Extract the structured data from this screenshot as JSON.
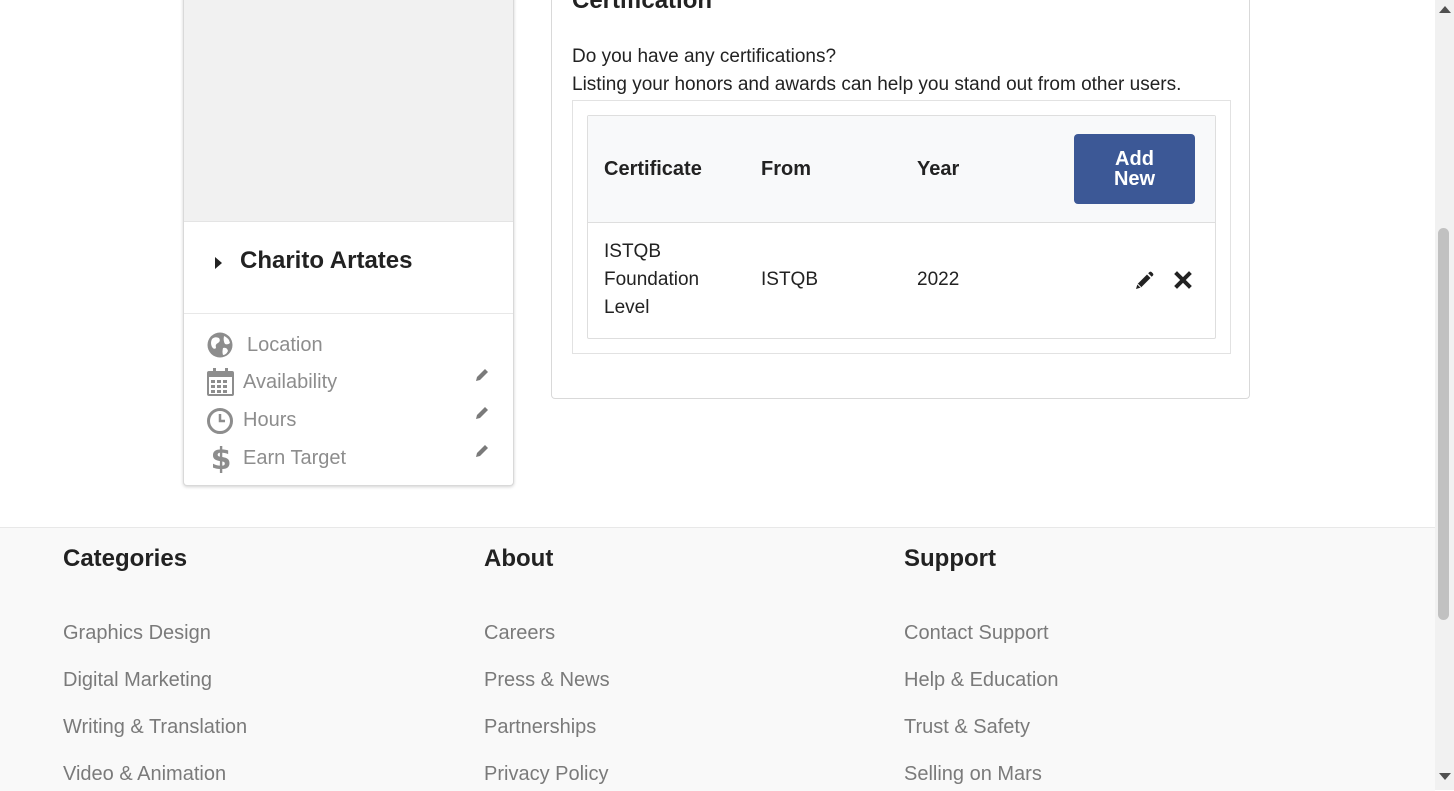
{
  "profile": {
    "name": "Charito Artates",
    "details": [
      {
        "label": "Location",
        "icon": "globe-icon",
        "editable": false
      },
      {
        "label": "Availability",
        "icon": "calendar-icon",
        "editable": true
      },
      {
        "label": "Hours",
        "icon": "clock-icon",
        "editable": true
      },
      {
        "label": "Earn Target",
        "icon": "dollar-icon",
        "editable": true
      }
    ]
  },
  "certification": {
    "title": "Certification",
    "question": "Do you have any certifications?",
    "description": "Listing your honors and awards can help you stand out from other users.",
    "columns": [
      "Certificate",
      "From",
      "Year"
    ],
    "add_button": "Add New",
    "rows": [
      {
        "certificate": "ISTQB Foundation Level",
        "from": "ISTQB",
        "year": "2022"
      }
    ]
  },
  "footer": {
    "columns": [
      {
        "heading": "Categories",
        "links": [
          "Graphics Design",
          "Digital Marketing",
          "Writing & Translation",
          "Video & Animation"
        ]
      },
      {
        "heading": "About",
        "links": [
          "Careers",
          "Press & News",
          "Partnerships",
          "Privacy Policy"
        ]
      },
      {
        "heading": "Support",
        "links": [
          "Contact Support",
          "Help & Education",
          "Trust & Safety",
          "Selling on Mars"
        ]
      }
    ]
  },
  "colors": {
    "primary_button": "#3c5896",
    "muted_text": "#8d8d8d",
    "footer_bg": "#f9f9f9"
  }
}
